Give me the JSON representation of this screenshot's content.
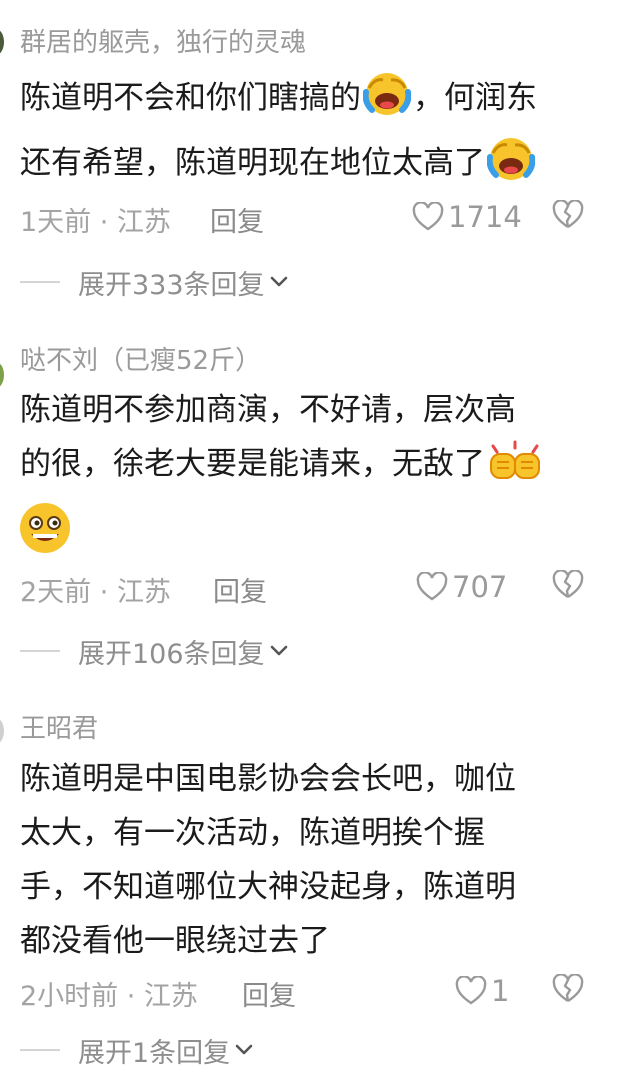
{
  "comments": [
    {
      "username": "群居的躯壳，独行的灵魂",
      "lines": [
        {
          "a": "陈道明不会和你们瞎搞的",
          "emoji": "laugh-cry-emoji",
          "b": "，何润东"
        },
        {
          "a": "还有希望，陈道明现在地位太高了",
          "emoji": "laugh-cry-emoji",
          "b": ""
        }
      ],
      "time": "1天前",
      "location": "江苏",
      "reply": "回复",
      "likes": "1714",
      "expand": "展开333条回复"
    },
    {
      "username": "哒不刘（已瘦52斤）",
      "lines": [
        {
          "a": "陈道明不参加商演，不好请，层次高",
          "emoji": "",
          "b": ""
        },
        {
          "a": "的很，徐老大要是能请来，无敌了",
          "emoji": "fist-bump-emoji",
          "b": ""
        },
        {
          "a": "",
          "emoji": "grin-emoji",
          "b": ""
        }
      ],
      "time": "2天前",
      "location": "江苏",
      "reply": "回复",
      "likes": "707",
      "expand": "展开106条回复"
    },
    {
      "username": "王昭君",
      "lines": [
        {
          "a": "陈道明是中国电影协会会长吧，咖位",
          "emoji": "",
          "b": ""
        },
        {
          "a": "太大，有一次活动，陈道明挨个握",
          "emoji": "",
          "b": ""
        },
        {
          "a": "手，不知道哪位大神没起身，陈道明",
          "emoji": "",
          "b": ""
        },
        {
          "a": "都没看他一眼绕过去了",
          "emoji": "",
          "b": ""
        }
      ],
      "time": "2小时前",
      "location": "江苏",
      "reply": "回复",
      "likes": "1",
      "expand": "展开1条回复"
    }
  ],
  "colors": {
    "text": "#1b1b1b",
    "muted": "#9a9a9a",
    "emoji_yellow": "#f7c52b",
    "emoji_red": "#e8484a"
  }
}
